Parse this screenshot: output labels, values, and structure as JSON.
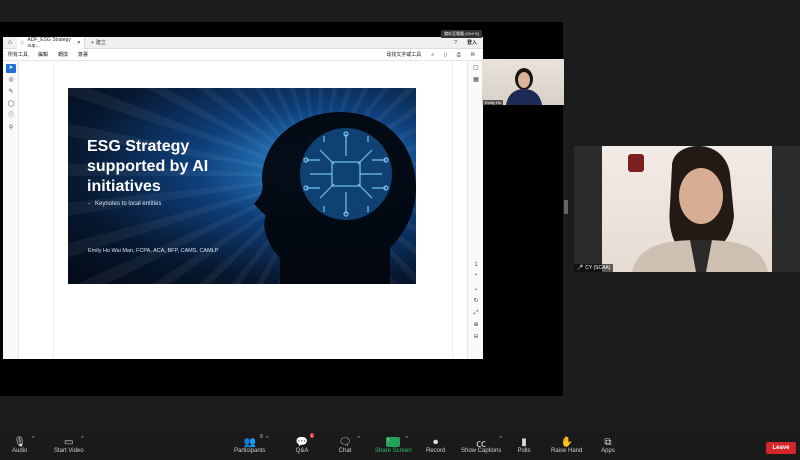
{
  "acrobat": {
    "tab_doc": "ADF_ESG Strategy sup...",
    "tab_new": "建立",
    "signin": "登入",
    "menu": [
      "所有工具",
      "編輯",
      "轉換",
      "簽署"
    ],
    "find_text": "尋找文字或工具",
    "tooltip": "儲存至電腦 (Ctrl+S)"
  },
  "slide": {
    "title_line1": "ESG Strategy",
    "title_line2": "supported by AI",
    "title_line3": "initiatives",
    "bullet": "Keynotes to local entities",
    "author": "Emily Ho Wai Man, FCPA, ACA, BFP, CAMS, CAMLP"
  },
  "participants": {
    "thumb_name": "Emily Ho",
    "big_name": "CY (SCAA)"
  },
  "toolbar": {
    "audio": "Audio",
    "start_video": "Start Video",
    "participants": "Participants",
    "participants_count": "9",
    "qa": "Q&A",
    "qa_badge": "1",
    "chat": "Chat",
    "share_screen": "Share Screen",
    "record": "Record",
    "show_captions": "Show Captions",
    "polls": "Polls",
    "raise_hand": "Raise Hand",
    "apps": "Apps",
    "leave": "Leave"
  },
  "colors": {
    "share_green": "#23a35a",
    "leave_red": "#d7262b",
    "acrobat_blue": "#1f6fd6"
  }
}
